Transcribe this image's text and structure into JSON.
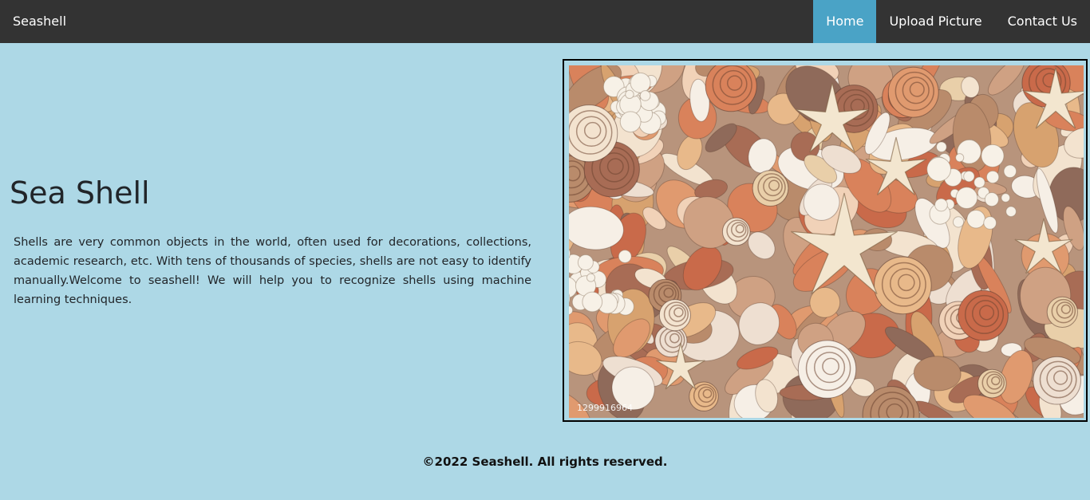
{
  "nav": {
    "brand": "Seashell",
    "links": [
      {
        "label": "Home",
        "active": true
      },
      {
        "label": "Upload Picture",
        "active": false
      },
      {
        "label": "Contact Us",
        "active": false
      }
    ]
  },
  "hero": {
    "title": "Sea Shell",
    "description": "Shells are very common objects in the world, often used for decorations, collections, academic research, etc. With tens of thousands of species, shells are not easy to identify manually.Welcome to seashell! We will help you to recognize shells using machine learning techniques."
  },
  "image": {
    "alt": "Seashells and starfish collection",
    "stock_id": "1299916964"
  },
  "footer": {
    "text": "©2022 Seashell. All rights reserved."
  },
  "colors": {
    "background": "#add8e6",
    "navbar": "#333333",
    "active_link": "#4aa3c6"
  }
}
